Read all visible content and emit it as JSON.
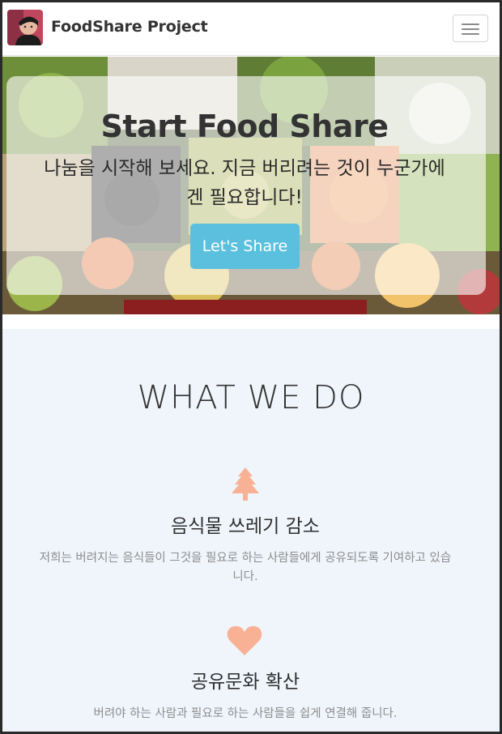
{
  "navbar": {
    "brand": "FoodShare Project",
    "avatar_icon": "profile-photo",
    "toggle_icon": "hamburger-menu-icon"
  },
  "hero": {
    "title": "Start Food Share",
    "subtitle_line1": "나눔을 시작해 보세요. 지금 버리려는 것이 누군가에",
    "subtitle_line2": "겐 필요합니다!",
    "button_label": "Let's Share",
    "button_color": "#5bc0de"
  },
  "services": {
    "heading": "WHAT WE DO",
    "accent_color": "#f8b195",
    "items": [
      {
        "icon": "tree-icon",
        "title": "음식물 쓰레기 감소",
        "desc_line1": "저희는 버려지는 음식들이 그것을 필요로 하는 사람들에게 공유되도록 기여하고 있습",
        "desc_line2": "니다."
      },
      {
        "icon": "heart-icon",
        "title": "공유문화 확산",
        "desc_line1": "버려야 하는 사람과 필요로 하는 사람들을 쉽게 연결해 줍니다.",
        "desc_line2": ""
      }
    ]
  }
}
